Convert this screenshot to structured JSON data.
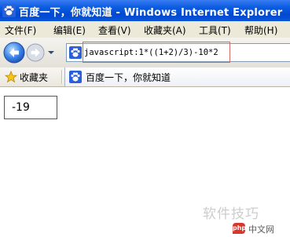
{
  "window": {
    "title": "百度一下，你就知道 - Windows Internet Explorer",
    "title_bar_color": "#0a5ce0"
  },
  "menu": {
    "items": [
      {
        "label": "文件(F)"
      },
      {
        "label": "编辑(E)"
      },
      {
        "label": "查看(V)"
      },
      {
        "label": "收藏夹(A)"
      },
      {
        "label": "工具(T)"
      },
      {
        "label": "帮助(H)"
      }
    ]
  },
  "address_bar": {
    "value": "javascript:1*((1+2)/3)-10*2",
    "site_icon": "baidu-paw-icon"
  },
  "favorites_bar": {
    "label": "收藏夹",
    "icon": "star-icon"
  },
  "tab": {
    "label": "百度一下，你就知道",
    "icon": "baidu-paw-icon"
  },
  "page": {
    "result": "-19"
  },
  "watermark": {
    "text": "软件技巧",
    "badge": "php",
    "site": "中文网"
  }
}
